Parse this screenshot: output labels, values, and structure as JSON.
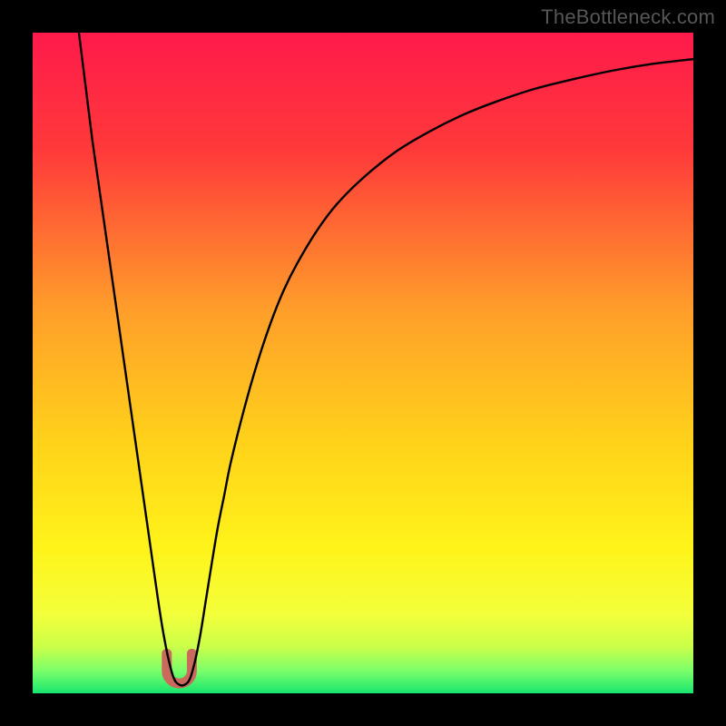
{
  "watermark": "TheBottleneck.com",
  "chart_data": {
    "type": "line",
    "title": "",
    "xlabel": "",
    "ylabel": "",
    "xlim": [
      0,
      100
    ],
    "ylim": [
      0,
      100
    ],
    "background_gradient_stops": [
      {
        "offset": 0.0,
        "color": "#ff1a4b"
      },
      {
        "offset": 0.18,
        "color": "#ff3a3a"
      },
      {
        "offset": 0.42,
        "color": "#ff9e2a"
      },
      {
        "offset": 0.62,
        "color": "#ffd21a"
      },
      {
        "offset": 0.78,
        "color": "#fff31a"
      },
      {
        "offset": 0.88,
        "color": "#f3ff3a"
      },
      {
        "offset": 0.93,
        "color": "#caff4a"
      },
      {
        "offset": 0.965,
        "color": "#7dff6a"
      },
      {
        "offset": 1.0,
        "color": "#18e56e"
      }
    ],
    "series": [
      {
        "name": "bottleneck-curve",
        "stroke": "#000000",
        "stroke_width": 2.4,
        "x": [
          7,
          8,
          9,
          10,
          11,
          12,
          13,
          14,
          15,
          16,
          17,
          18,
          19,
          19.8,
          20.6,
          21.4,
          22.2,
          23,
          23.8,
          24.6,
          25.4,
          26.2,
          27,
          28,
          29,
          30,
          32,
          34,
          36,
          38,
          40,
          43,
          46,
          50,
          55,
          60,
          65,
          70,
          76,
          82,
          88,
          94,
          100
        ],
        "y": [
          100,
          92,
          84,
          77,
          70,
          63,
          56,
          49,
          42,
          35,
          28,
          21,
          14,
          9,
          5,
          2.2,
          1.3,
          1.3,
          2.2,
          5,
          9,
          14,
          19,
          25,
          30,
          35,
          43,
          50,
          56,
          61,
          65,
          70,
          74,
          78,
          82,
          85,
          87.5,
          89.5,
          91.5,
          93,
          94.3,
          95.3,
          96
        ]
      }
    ],
    "marker": {
      "name": "minimum-highlight",
      "shape": "u-notch",
      "color": "#c96a5d",
      "x_center": 22.2,
      "width": 3.8,
      "y_top": 6.0,
      "y_bottom": 1.5
    }
  }
}
